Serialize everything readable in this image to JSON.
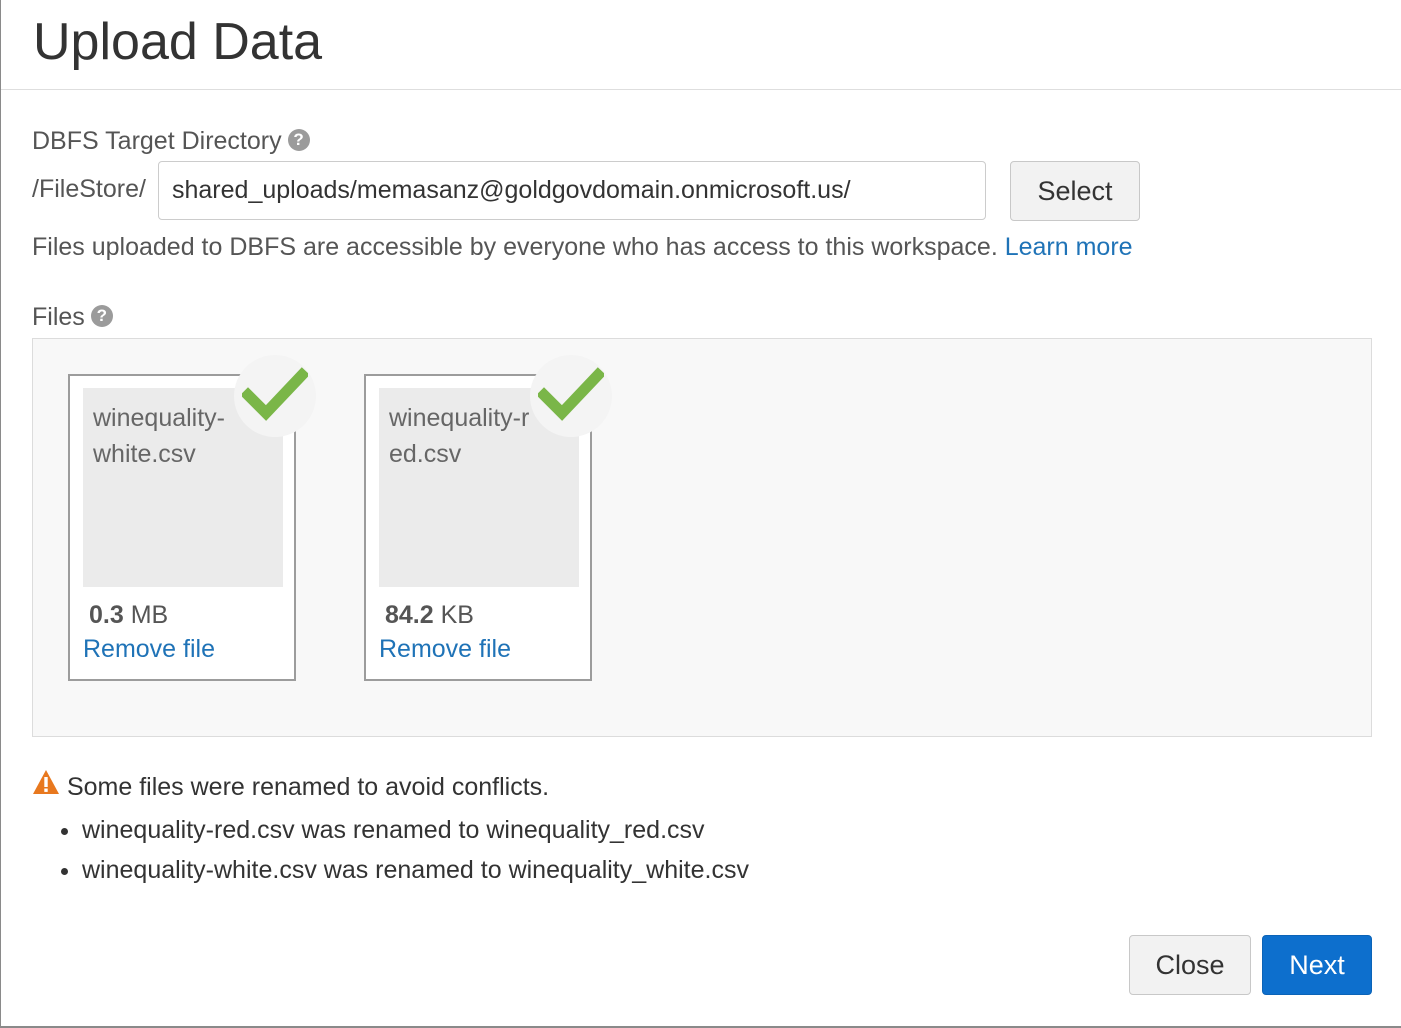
{
  "dialog": {
    "title": "Upload Data"
  },
  "target": {
    "label": "DBFS Target Directory",
    "help_icon": "question-circle-icon",
    "prefix": "/FileStore/",
    "directory_value": "shared_uploads/memasanz@goldgovdomain.onmicrosoft.us/",
    "select_label": "Select",
    "note": "Files uploaded to DBFS are accessible by everyone who has access to this workspace.",
    "learn_more": "Learn more"
  },
  "files": {
    "label": "Files",
    "help_icon": "question-circle-icon",
    "items": [
      {
        "name": "winequality-white.csv",
        "size_value": "0.3",
        "size_unit": "MB",
        "status_icon": "check-icon",
        "remove_label": "Remove file"
      },
      {
        "name": "winequality-red.csv",
        "size_value": "84.2",
        "size_unit": "KB",
        "status_icon": "check-icon",
        "remove_label": "Remove file"
      }
    ]
  },
  "warning": {
    "icon": "warning-triangle-icon",
    "message": "Some files were renamed to avoid conflicts.",
    "renames": [
      "winequality-red.csv was renamed to winequality_red.csv",
      "winequality-white.csv was renamed to winequality_white.csv"
    ]
  },
  "footer": {
    "close_label": "Close",
    "next_label": "Next"
  },
  "colors": {
    "primary": "#0d6fcd",
    "link": "#1f73b7",
    "success": "#7ab648",
    "warning": "#e8781e"
  }
}
